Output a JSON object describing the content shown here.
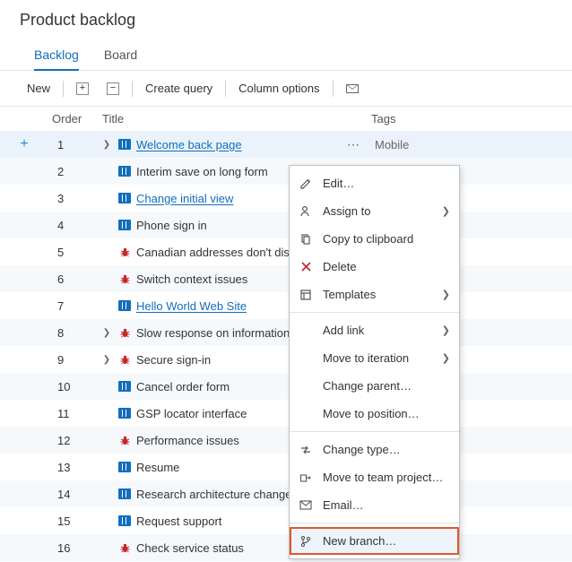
{
  "page": {
    "title": "Product backlog"
  },
  "tabs": {
    "backlog": "Backlog",
    "board": "Board"
  },
  "toolbar": {
    "new": "New",
    "create_query": "Create query",
    "column_options": "Column options"
  },
  "columns": {
    "order": "Order",
    "title": "Title",
    "tags": "Tags"
  },
  "rows": [
    {
      "order": "1",
      "type": "pbi",
      "expand": true,
      "title": "Welcome back page",
      "linked": true,
      "more": true,
      "tag": "Mobile"
    },
    {
      "order": "2",
      "type": "pbi",
      "expand": false,
      "title": "Interim save on long form",
      "linked": false
    },
    {
      "order": "3",
      "type": "pbi",
      "expand": false,
      "title": "Change initial view",
      "linked": true
    },
    {
      "order": "4",
      "type": "pbi",
      "expand": false,
      "title": "Phone sign in",
      "linked": false
    },
    {
      "order": "5",
      "type": "bug",
      "expand": false,
      "title": "Canadian addresses don't disp",
      "linked": false
    },
    {
      "order": "6",
      "type": "bug",
      "expand": false,
      "title": "Switch context issues",
      "linked": false
    },
    {
      "order": "7",
      "type": "pbi",
      "expand": false,
      "title": "Hello World Web Site",
      "linked": true
    },
    {
      "order": "8",
      "type": "bug",
      "expand": true,
      "title": "Slow response on information",
      "linked": false
    },
    {
      "order": "9",
      "type": "bug",
      "expand": true,
      "title": "Secure sign-in",
      "linked": false
    },
    {
      "order": "10",
      "type": "pbi",
      "expand": false,
      "title": "Cancel order form",
      "linked": false
    },
    {
      "order": "11",
      "type": "pbi",
      "expand": false,
      "title": "GSP locator interface",
      "linked": false
    },
    {
      "order": "12",
      "type": "bug",
      "expand": false,
      "title": "Performance issues",
      "linked": false
    },
    {
      "order": "13",
      "type": "pbi",
      "expand": false,
      "title": "Resume",
      "linked": false
    },
    {
      "order": "14",
      "type": "pbi",
      "expand": false,
      "title": "Research architecture changes",
      "linked": false
    },
    {
      "order": "15",
      "type": "pbi",
      "expand": false,
      "title": "Request support",
      "linked": false
    },
    {
      "order": "16",
      "type": "bug",
      "expand": false,
      "title": "Check service status",
      "linked": false
    }
  ],
  "context_menu": {
    "edit": "Edit…",
    "assign_to": "Assign to",
    "copy": "Copy to clipboard",
    "delete": "Delete",
    "templates": "Templates",
    "add_link": "Add link",
    "move_iteration": "Move to iteration",
    "change_parent": "Change parent…",
    "move_position": "Move to position…",
    "change_type": "Change type…",
    "move_team": "Move to team project…",
    "email": "Email…",
    "new_branch": "New branch…"
  }
}
